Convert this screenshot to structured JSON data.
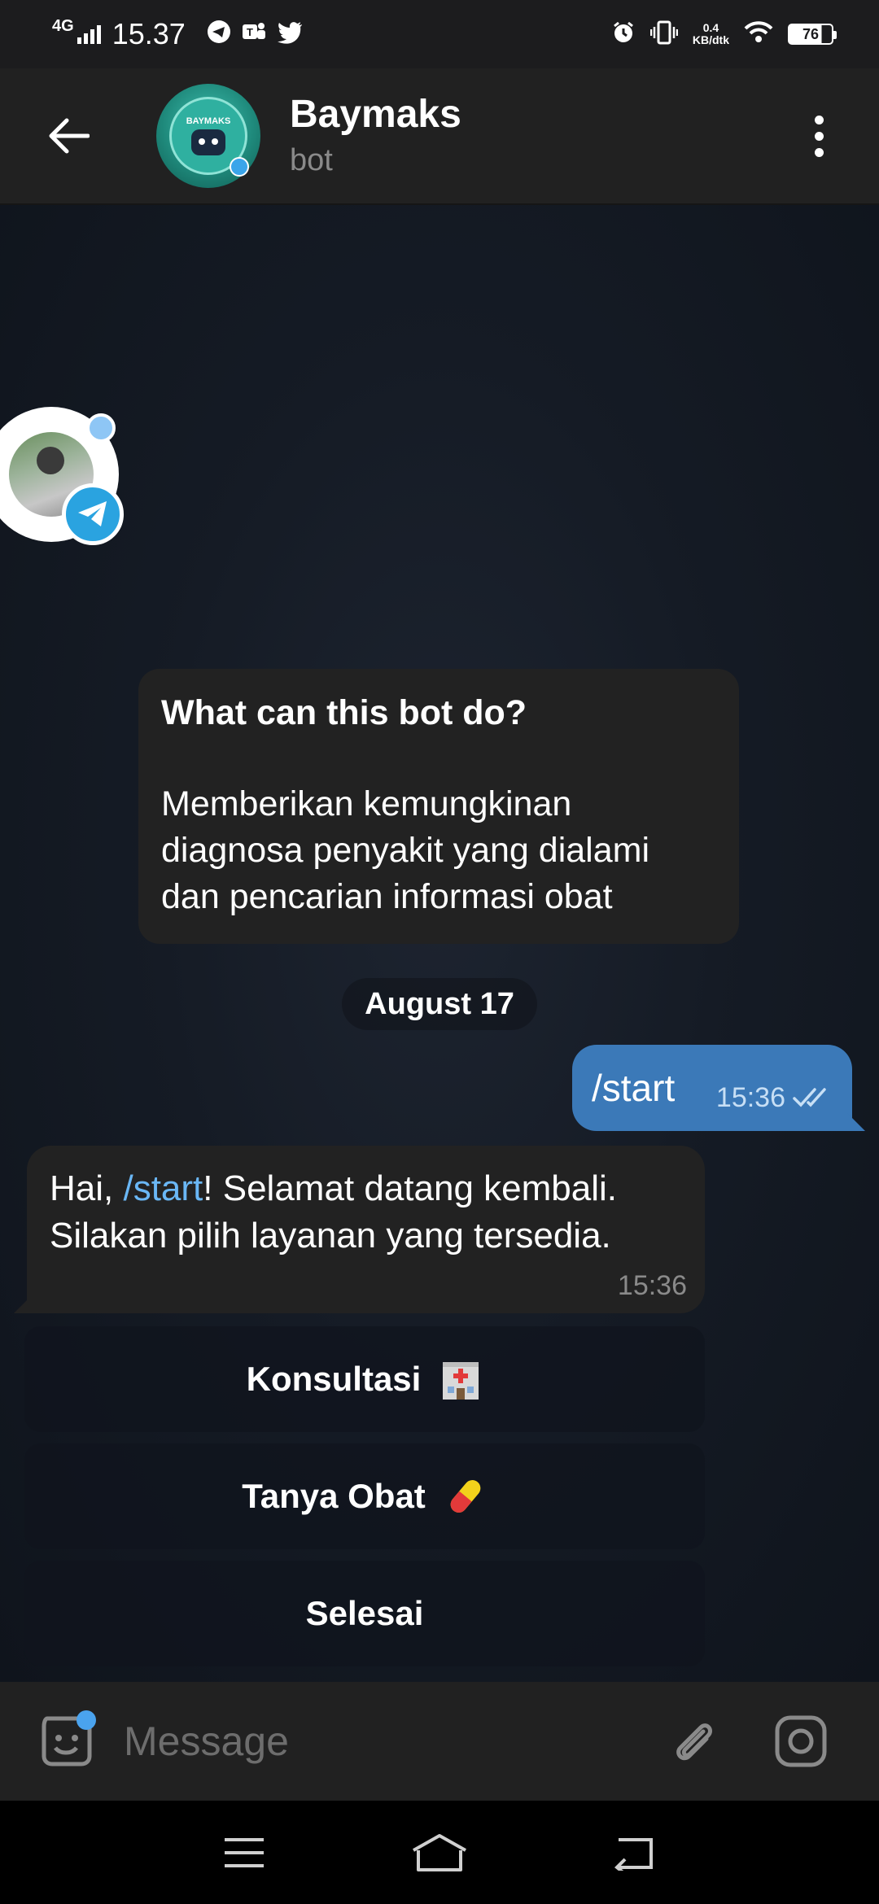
{
  "status_bar": {
    "network": "4G",
    "time": "15.37",
    "speed_value": "0.4",
    "speed_unit": "KB/dtk",
    "battery": "76",
    "icons": [
      "telegram-icon",
      "teams-icon",
      "twitter-icon",
      "alarm-icon",
      "vibrate-icon",
      "wifi-icon",
      "battery-icon"
    ]
  },
  "header": {
    "title": "Baymaks",
    "subtitle": "bot",
    "avatar_text": "BAYMAKS"
  },
  "info_card": {
    "title": "What can this bot do?",
    "body": "Memberikan kemungkinan diagnosa penyakit yang dialami dan pencarian informasi obat"
  },
  "date_chip": "August 17",
  "messages": {
    "outgoing": {
      "text": "/start",
      "time": "15:36",
      "status": "read"
    },
    "incoming": {
      "prefix": "Hai, ",
      "command": "/start",
      "suffix": "! Selamat datang kembali. Silakan pilih layanan yang tersedia.",
      "time": "15:36"
    }
  },
  "keyboard": {
    "buttons": [
      {
        "label": "Konsultasi",
        "emoji": "hospital-emoji"
      },
      {
        "label": "Tanya Obat",
        "emoji": "pill-emoji"
      },
      {
        "label": "Selesai"
      }
    ]
  },
  "input": {
    "placeholder": "Message",
    "value": ""
  },
  "colors": {
    "outgoing_bubble": "#3b79b8",
    "incoming_bubble": "#222222",
    "link": "#6ab7f5",
    "header_bg": "#212121"
  }
}
